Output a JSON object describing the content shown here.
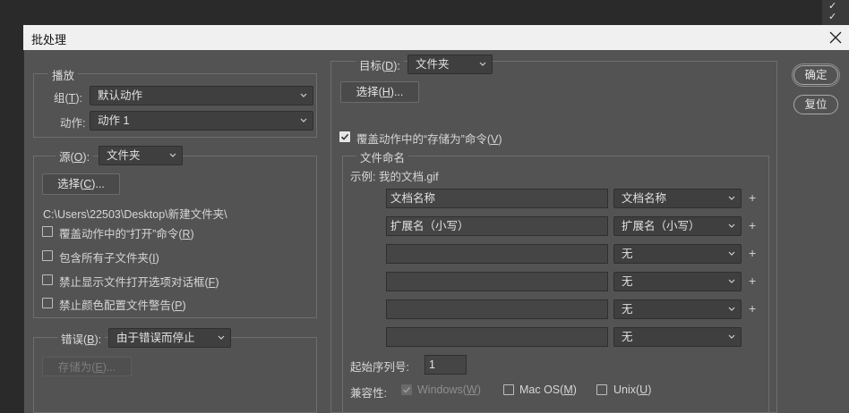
{
  "dialog": {
    "title": "批处理",
    "close_icon": "close-icon"
  },
  "buttons": {
    "ok": "确定",
    "reset": "复位"
  },
  "play": {
    "legend": "播放",
    "set_label": "组(T):",
    "set_value": "默认动作",
    "action_label": "动作:",
    "action_value": "动作 1"
  },
  "source": {
    "legend_label": "源(O):",
    "value": "文件夹",
    "choose_button": "选择(C)...",
    "path": "C:\\Users\\22503\\Desktop\\新建文件夹\\",
    "checkboxes": [
      {
        "label": "覆盖动作中的“打开”命令(R)",
        "checked": false
      },
      {
        "label": "包含所有子文件夹(I)",
        "checked": false
      },
      {
        "label": "禁止显示文件打开选项对话框(F)",
        "checked": false
      },
      {
        "label": "禁止颜色配置文件警告(P)",
        "checked": false
      }
    ]
  },
  "errors": {
    "label": "错误(B):",
    "value": "由于错误而停止",
    "save_as_button": "存储为(E)..."
  },
  "destination": {
    "label": "目标(D):",
    "value": "文件夹",
    "choose_button": "选择(H)...",
    "override_save": {
      "label": "覆盖动作中的“存储为”命令(V)",
      "checked": true
    }
  },
  "file_naming": {
    "legend": "文件命名",
    "example": "示例: 我的文档.gif",
    "rows": [
      {
        "text": "文档名称",
        "select": "文档名称",
        "plus": "+"
      },
      {
        "text": "扩展名（小写）",
        "select": "扩展名（小写）",
        "plus": "+"
      },
      {
        "text": "",
        "select": "无",
        "plus": "+"
      },
      {
        "text": "",
        "select": "无",
        "plus": "+"
      },
      {
        "text": "",
        "select": "无",
        "plus": "+"
      },
      {
        "text": "",
        "select": "无",
        "plus": ""
      }
    ],
    "serial_label": "起始序列号:",
    "serial_value": "1",
    "compat_label": "兼容性:",
    "compat": [
      {
        "label": "Windows(W)",
        "checked": true,
        "disabled": true
      },
      {
        "label": "Mac OS(M)",
        "checked": false,
        "disabled": false
      },
      {
        "label": "Unix(U)",
        "checked": false,
        "disabled": false
      }
    ]
  }
}
